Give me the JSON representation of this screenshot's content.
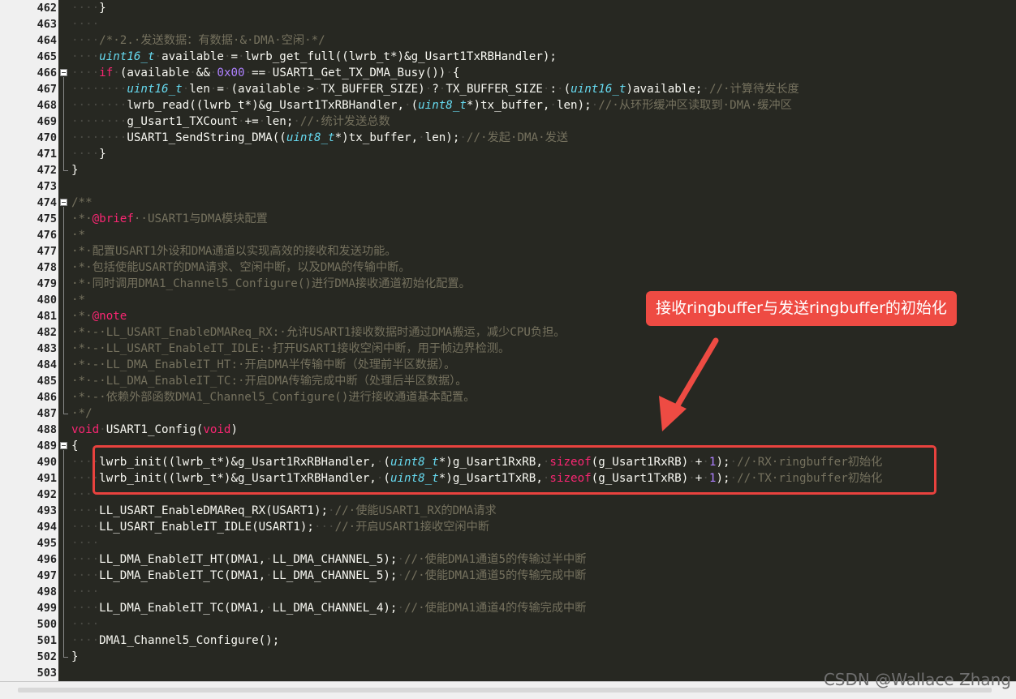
{
  "editor": {
    "lines": [
      {
        "n": "462",
        "segs": [
          [
            "dt",
            "····"
          ],
          [
            "",
            "}"
          ]
        ]
      },
      {
        "n": "463",
        "segs": [
          [
            "dt",
            "····"
          ]
        ]
      },
      {
        "n": "464",
        "segs": [
          [
            "dt",
            "····"
          ],
          [
            "cm",
            "/*·2.·发送数据：有数据·&·DMA·空闲·*/"
          ]
        ]
      },
      {
        "n": "465",
        "segs": [
          [
            "dt",
            "····"
          ],
          [
            "ty",
            "uint16_t"
          ],
          [
            "",
            ""
          ],
          [
            "dt",
            "·"
          ],
          [
            "",
            "available"
          ],
          [
            "dt",
            "·"
          ],
          [
            "",
            "="
          ],
          [
            "dt",
            "·"
          ],
          [
            "",
            "lwrb_get_full((lwrb_t*)&g_Usart1TxRBHandler);"
          ]
        ]
      },
      {
        "n": "466",
        "segs": [
          [
            "dt",
            "····"
          ],
          [
            "kw",
            "if"
          ],
          [
            "dt",
            "·"
          ],
          [
            "",
            "(available"
          ],
          [
            "dt",
            "·"
          ],
          [
            "",
            "&&"
          ],
          [
            "dt",
            "·"
          ],
          [
            "nu",
            "0x00"
          ],
          [
            "dt",
            "·"
          ],
          [
            "",
            "=="
          ],
          [
            "dt",
            "·"
          ],
          [
            "",
            "USART1_Get_TX_DMA_Busy())"
          ],
          [
            "dt",
            "·"
          ],
          [
            "",
            "{"
          ]
        ]
      },
      {
        "n": "467",
        "segs": [
          [
            "dt",
            "········"
          ],
          [
            "ty",
            "uint16_t"
          ],
          [
            "dt",
            "·"
          ],
          [
            "",
            "len"
          ],
          [
            "dt",
            "·"
          ],
          [
            "",
            "="
          ],
          [
            "dt",
            "·"
          ],
          [
            "",
            "(available"
          ],
          [
            "dt",
            "·"
          ],
          [
            "",
            ">"
          ],
          [
            "dt",
            "·"
          ],
          [
            "",
            "TX_BUFFER_SIZE)"
          ],
          [
            "dt",
            "·"
          ],
          [
            "",
            "?"
          ],
          [
            "dt",
            "·"
          ],
          [
            "",
            "TX_BUFFER_SIZE"
          ],
          [
            "dt",
            "·"
          ],
          [
            "",
            ":"
          ],
          [
            "dt",
            "·"
          ],
          [
            "",
            "("
          ],
          [
            "ty",
            "uint16_t"
          ],
          [
            "",
            ")available;"
          ],
          [
            "dt",
            "·"
          ],
          [
            "cm",
            "//·计算待发长度"
          ]
        ]
      },
      {
        "n": "468",
        "segs": [
          [
            "dt",
            "········"
          ],
          [
            "",
            "lwrb_read((lwrb_t*)&g_Usart1TxRBHandler,"
          ],
          [
            "dt",
            "·"
          ],
          [
            "",
            "("
          ],
          [
            "ty",
            "uint8_t"
          ],
          [
            "",
            "*)tx_buffer,"
          ],
          [
            "dt",
            "·"
          ],
          [
            "",
            "len);"
          ],
          [
            "dt",
            "·"
          ],
          [
            "cm",
            "//·从环形缓冲区读取到·DMA·缓冲区"
          ]
        ]
      },
      {
        "n": "469",
        "segs": [
          [
            "dt",
            "········"
          ],
          [
            "",
            "g_Usart1_TXCount"
          ],
          [
            "dt",
            "·"
          ],
          [
            "",
            "+="
          ],
          [
            "dt",
            "·"
          ],
          [
            "",
            "len;"
          ],
          [
            "dt",
            "·"
          ],
          [
            "cm",
            "//·统计发送总数"
          ]
        ]
      },
      {
        "n": "470",
        "segs": [
          [
            "dt",
            "········"
          ],
          [
            "",
            "USART1_SendString_DMA(("
          ],
          [
            "ty",
            "uint8_t"
          ],
          [
            "",
            "*)tx_buffer,"
          ],
          [
            "dt",
            "·"
          ],
          [
            "",
            "len);"
          ],
          [
            "dt",
            "·"
          ],
          [
            "cm",
            "//·发起·DMA·发送"
          ]
        ]
      },
      {
        "n": "471",
        "segs": [
          [
            "dt",
            "····"
          ],
          [
            "",
            "}"
          ]
        ]
      },
      {
        "n": "472",
        "segs": [
          [
            "",
            "}"
          ]
        ]
      },
      {
        "n": "473",
        "segs": []
      },
      {
        "n": "474",
        "segs": [
          [
            "cm",
            "/**"
          ]
        ]
      },
      {
        "n": "475",
        "segs": [
          [
            "cm",
            "·*·"
          ],
          [
            "kw",
            "@brief"
          ],
          [
            "cm",
            "··USART1与DMA模块配置"
          ]
        ]
      },
      {
        "n": "476",
        "segs": [
          [
            "cm",
            "·*"
          ]
        ]
      },
      {
        "n": "477",
        "segs": [
          [
            "cm",
            "·*·配置USART1外设和DMA通道以实现高效的接收和发送功能。"
          ]
        ]
      },
      {
        "n": "478",
        "segs": [
          [
            "cm",
            "·*·包括使能USART的DMA请求、空闲中断，以及DMA的传输中断。"
          ]
        ]
      },
      {
        "n": "479",
        "segs": [
          [
            "cm",
            "·*·同时调用DMA1_Channel5_Configure()进行DMA接收通道初始化配置。"
          ]
        ]
      },
      {
        "n": "480",
        "segs": [
          [
            "cm",
            "·*"
          ]
        ]
      },
      {
        "n": "481",
        "segs": [
          [
            "cm",
            "·*·"
          ],
          [
            "kw",
            "@note"
          ]
        ]
      },
      {
        "n": "482",
        "segs": [
          [
            "cm",
            "·*·-·LL_USART_EnableDMAReq_RX:·允许USART1接收数据时通过DMA搬运，减少CPU负担。"
          ]
        ]
      },
      {
        "n": "483",
        "segs": [
          [
            "cm",
            "·*·-·LL_USART_EnableIT_IDLE:·打开USART1接收空闲中断，用于帧边界检测。"
          ]
        ]
      },
      {
        "n": "484",
        "segs": [
          [
            "cm",
            "·*·-·LL_DMA_EnableIT_HT:·开启DMA半传输中断（处理前半区数据）。"
          ]
        ]
      },
      {
        "n": "485",
        "segs": [
          [
            "cm",
            "·*·-·LL_DMA_EnableIT_TC:·开启DMA传输完成中断（处理后半区数据）。"
          ]
        ]
      },
      {
        "n": "486",
        "segs": [
          [
            "cm",
            "·*·-·依赖外部函数DMA1_Channel5_Configure()进行接收通道基本配置。"
          ]
        ]
      },
      {
        "n": "487",
        "segs": [
          [
            "cm",
            "·*/"
          ]
        ]
      },
      {
        "n": "488",
        "segs": [
          [
            "kw",
            "void"
          ],
          [
            "dt",
            "·"
          ],
          [
            "",
            "USART1_Config("
          ],
          [
            "kw",
            "void"
          ],
          [
            "",
            ")"
          ]
        ]
      },
      {
        "n": "489",
        "segs": [
          [
            "",
            "{"
          ]
        ]
      },
      {
        "n": "490",
        "segs": [
          [
            "dt",
            "····"
          ],
          [
            "",
            "lwrb_init((lwrb_t*)&g_Usart1RxRBHandler,"
          ],
          [
            "dt",
            "·"
          ],
          [
            "",
            "("
          ],
          [
            "ty",
            "uint8_t"
          ],
          [
            "",
            "*)g_Usart1RxRB,"
          ],
          [
            "dt",
            "·"
          ],
          [
            "kw",
            "sizeof"
          ],
          [
            "",
            "(g_Usart1RxRB)"
          ],
          [
            "dt",
            "·"
          ],
          [
            "",
            "+"
          ],
          [
            "dt",
            "·"
          ],
          [
            "nu",
            "1"
          ],
          [
            "",
            ");"
          ],
          [
            "dt",
            "·"
          ],
          [
            "cm",
            "//·RX·ringbuffer初始化"
          ]
        ]
      },
      {
        "n": "491",
        "segs": [
          [
            "dt",
            "····"
          ],
          [
            "",
            "lwrb_init((lwrb_t*)&g_Usart1TxRBHandler,"
          ],
          [
            "dt",
            "·"
          ],
          [
            "",
            "("
          ],
          [
            "ty",
            "uint8_t"
          ],
          [
            "",
            "*)g_Usart1TxRB,"
          ],
          [
            "dt",
            "·"
          ],
          [
            "kw",
            "sizeof"
          ],
          [
            "",
            "(g_Usart1TxRB)"
          ],
          [
            "dt",
            "·"
          ],
          [
            "",
            "+"
          ],
          [
            "dt",
            "·"
          ],
          [
            "nu",
            "1"
          ],
          [
            "",
            ");"
          ],
          [
            "dt",
            "·"
          ],
          [
            "cm",
            "//·TX·ringbuffer初始化"
          ]
        ]
      },
      {
        "n": "492",
        "segs": [
          [
            "dt",
            "····"
          ]
        ]
      },
      {
        "n": "493",
        "segs": [
          [
            "dt",
            "····"
          ],
          [
            "",
            "LL_USART_EnableDMAReq_RX(USART1);"
          ],
          [
            "dt",
            "·"
          ],
          [
            "cm",
            "//·使能USART1_RX的DMA请求"
          ]
        ]
      },
      {
        "n": "494",
        "segs": [
          [
            "dt",
            "····"
          ],
          [
            "",
            "LL_USART_EnableIT_IDLE(USART1);"
          ],
          [
            "dt",
            "···"
          ],
          [
            "cm",
            "//·开启USART1接收空闲中断"
          ]
        ]
      },
      {
        "n": "495",
        "segs": [
          [
            "dt",
            "····"
          ]
        ]
      },
      {
        "n": "496",
        "segs": [
          [
            "dt",
            "····"
          ],
          [
            "",
            "LL_DMA_EnableIT_HT(DMA1,"
          ],
          [
            "dt",
            "·"
          ],
          [
            "",
            "LL_DMA_CHANNEL_5);"
          ],
          [
            "dt",
            "·"
          ],
          [
            "cm",
            "//·使能DMA1通道5的传输过半中断"
          ]
        ]
      },
      {
        "n": "497",
        "segs": [
          [
            "dt",
            "····"
          ],
          [
            "",
            "LL_DMA_EnableIT_TC(DMA1,"
          ],
          [
            "dt",
            "·"
          ],
          [
            "",
            "LL_DMA_CHANNEL_5);"
          ],
          [
            "dt",
            "·"
          ],
          [
            "cm",
            "//·使能DMA1通道5的传输完成中断"
          ]
        ]
      },
      {
        "n": "498",
        "segs": [
          [
            "dt",
            "····"
          ]
        ]
      },
      {
        "n": "499",
        "segs": [
          [
            "dt",
            "····"
          ],
          [
            "",
            "LL_DMA_EnableIT_TC(DMA1,"
          ],
          [
            "dt",
            "·"
          ],
          [
            "",
            "LL_DMA_CHANNEL_4);"
          ],
          [
            "dt",
            "·"
          ],
          [
            "cm",
            "//·使能DMA1通道4的传输完成中断"
          ]
        ]
      },
      {
        "n": "500",
        "segs": [
          [
            "dt",
            "····"
          ]
        ]
      },
      {
        "n": "501",
        "segs": [
          [
            "dt",
            "····"
          ],
          [
            "",
            "DMA1_Channel5_Configure();"
          ]
        ]
      },
      {
        "n": "502",
        "segs": [
          [
            "",
            "}"
          ]
        ]
      },
      {
        "n": "503",
        "segs": []
      }
    ],
    "fold_markers_at": [
      "466",
      "474",
      "489"
    ]
  },
  "annotation": {
    "callout_text": "接收ringbuffer与发送ringbuffer的初始化",
    "color": "#ee4b43"
  },
  "watermark": "CSDN @Wallace Zhang",
  "colors": {
    "background": "#272822",
    "comment": "#75715e",
    "keyword": "#f92672",
    "type": "#66d9ef",
    "number": "#ae81ff"
  }
}
